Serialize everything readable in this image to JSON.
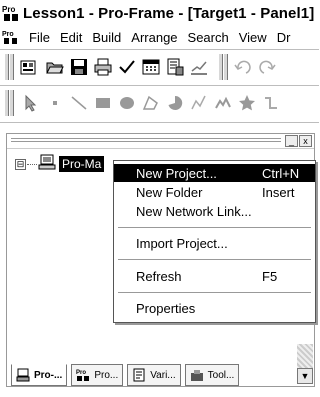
{
  "window": {
    "title": "Lesson1 - Pro-Frame - [Target1 - Panel1]"
  },
  "menubar": {
    "items": [
      "File",
      "Edit",
      "Build",
      "Arrange",
      "Search",
      "View",
      "Dr"
    ]
  },
  "tree": {
    "root_label": "Pro-Ma",
    "expander": "⊟"
  },
  "context_menu": {
    "items": [
      {
        "label": "New Project...",
        "shortcut": "Ctrl+N"
      },
      {
        "label": "New Folder",
        "shortcut": "Insert"
      },
      {
        "label": "New Network Link...",
        "shortcut": ""
      },
      {
        "label": "Import Project...",
        "shortcut": ""
      },
      {
        "label": "Refresh",
        "shortcut": "F5"
      },
      {
        "label": "Properties",
        "shortcut": ""
      }
    ]
  },
  "tabs": [
    "Pro-...",
    "Pro...",
    "Vari...",
    "Tool..."
  ],
  "panel": {
    "min_glyph": "_",
    "close_glyph": "x",
    "scroll_down_glyph": "▼"
  }
}
